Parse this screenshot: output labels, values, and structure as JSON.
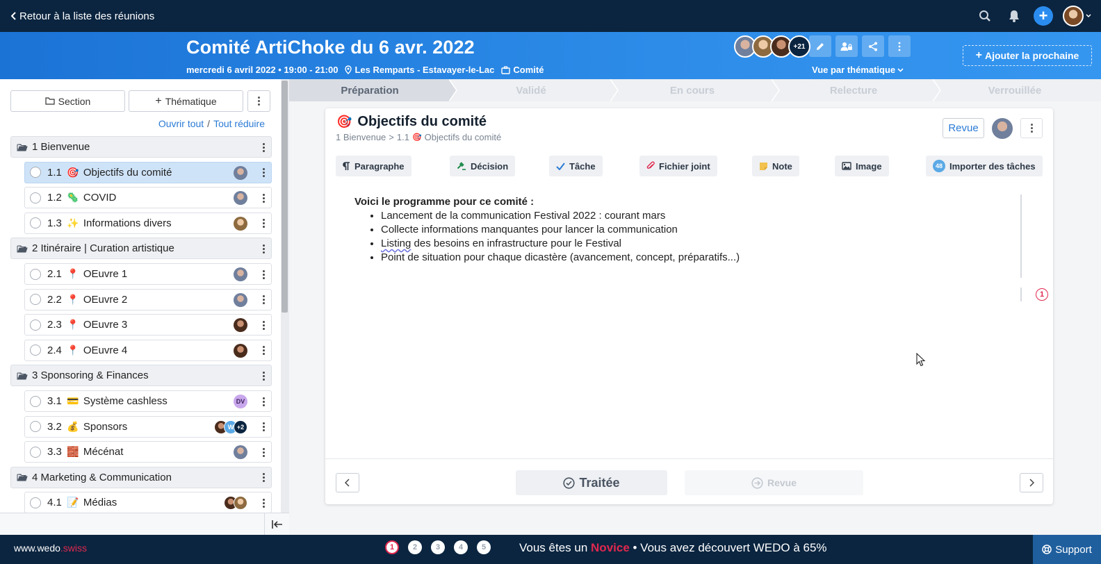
{
  "topnav": {
    "back_label": "Retour à la liste des réunions",
    "icons": [
      "search-icon",
      "bell-icon",
      "plus-icon",
      "user-avatar"
    ]
  },
  "meeting": {
    "title": "Comité ArtiChoke du 6 avr. 2022",
    "date": "mercredi 6 avril 2022 • 19:00 - 21:00",
    "location": "Les Remparts - Estavayer-le-Lac",
    "type": "Comité",
    "participants_more": "+21",
    "view_label": "Vue par thématique",
    "add_next_label": "Ajouter la prochaine"
  },
  "leftpanel": {
    "section_btn": "Section",
    "thematic_btn": "Thématique",
    "open_all": "Ouvrir tout",
    "separator": "/",
    "collapse_all": "Tout réduire"
  },
  "tree": [
    {
      "kind": "section",
      "label": "1 Bienvenue"
    },
    {
      "kind": "item",
      "num": "1.1",
      "emoji": "🎯",
      "label": "Objectifs du comité",
      "active": true,
      "avatar": "av-a"
    },
    {
      "kind": "item",
      "num": "1.2",
      "emoji": "🦠",
      "label": "COVID",
      "avatar": "av-a"
    },
    {
      "kind": "item",
      "num": "1.3",
      "emoji": "✨",
      "label": "Informations divers",
      "avatar": "av-b"
    },
    {
      "kind": "section",
      "label": "2 Itinéraire | Curation artistique"
    },
    {
      "kind": "item",
      "num": "2.1",
      "emoji": "📍",
      "label": "OEuvre 1",
      "avatar": "av-a"
    },
    {
      "kind": "item",
      "num": "2.2",
      "emoji": "📍",
      "label": "OEuvre 2",
      "avatar": "av-a"
    },
    {
      "kind": "item",
      "num": "2.3",
      "emoji": "📍",
      "label": "OEuvre 3",
      "avatar": "av-c"
    },
    {
      "kind": "item",
      "num": "2.4",
      "emoji": "📍",
      "label": "OEuvre 4",
      "avatar": "av-c"
    },
    {
      "kind": "section",
      "label": "3 Sponsoring & Finances"
    },
    {
      "kind": "item",
      "num": "3.1",
      "emoji": "💳",
      "label": "Système cashless",
      "avatar": "dv",
      "avatar_text": "DV"
    },
    {
      "kind": "item",
      "num": "3.2",
      "emoji": "💰",
      "label": "Sponsors",
      "avatar": "group",
      "group_text": [
        "",
        "W",
        "+2"
      ]
    },
    {
      "kind": "item",
      "num": "3.3",
      "emoji": "🧱",
      "label": "Mécénat",
      "avatar": "av-a"
    },
    {
      "kind": "section",
      "label": "4 Marketing & Communication"
    },
    {
      "kind": "item",
      "num": "4.1",
      "emoji": "📝",
      "label": "Médias",
      "avatar": "pair"
    }
  ],
  "steps": [
    "Préparation",
    "Validé",
    "En cours",
    "Relecture",
    "Verrouillée"
  ],
  "topic": {
    "emoji": "🎯",
    "title": "Objectifs du comité",
    "breadcrumb_1": "1 Bienvenue",
    "breadcrumb_sep": ">",
    "breadcrumb_2": "1.1",
    "breadcrumb_3": "Objectifs du comité",
    "revue_label": "Revue"
  },
  "toolbar": [
    {
      "label": "Paragraphe",
      "icon": "paragraph-icon"
    },
    {
      "label": "Décision",
      "icon": "gavel-icon"
    },
    {
      "label": "Tâche",
      "icon": "check-icon"
    },
    {
      "label": "Fichier joint",
      "icon": "paperclip-icon"
    },
    {
      "label": "Note",
      "icon": "sticky-note-icon"
    },
    {
      "label": "Image",
      "icon": "image-icon"
    },
    {
      "label": "Importer des tâches",
      "icon": "import-icon",
      "badge": "48"
    }
  ],
  "content": {
    "lead": "Voici le programme pour ce comité :",
    "bullets": [
      "Lancement de la communication Festival 2022 : courant mars",
      "Collecte informations manquantes pour lancer la communication",
      "Listing",
      "Point de situation pour chaque dicastère (avancement, concept, préparatifs...)"
    ],
    "bullet3_rest": " des besoins en infrastructure pour le Festival",
    "comment_count": "1"
  },
  "footer": {
    "traitee_label": "Traitée",
    "revue_label": "Revue"
  },
  "bottombar": {
    "site_main": "www.wedo",
    "site_ext": ".swiss",
    "steps": [
      "1",
      "2",
      "3",
      "4",
      "5"
    ],
    "msg_prefix": "Vous êtes un ",
    "level": "Novice",
    "msg_suffix": " • Vous avez découvert WEDO à 65%",
    "discovered_percent": 65,
    "support_label": "Support"
  },
  "colors": {
    "navy": "#0b2540",
    "blue": "#2d8ce8",
    "accent_red": "#e0284f",
    "link": "#2b7bd5"
  }
}
